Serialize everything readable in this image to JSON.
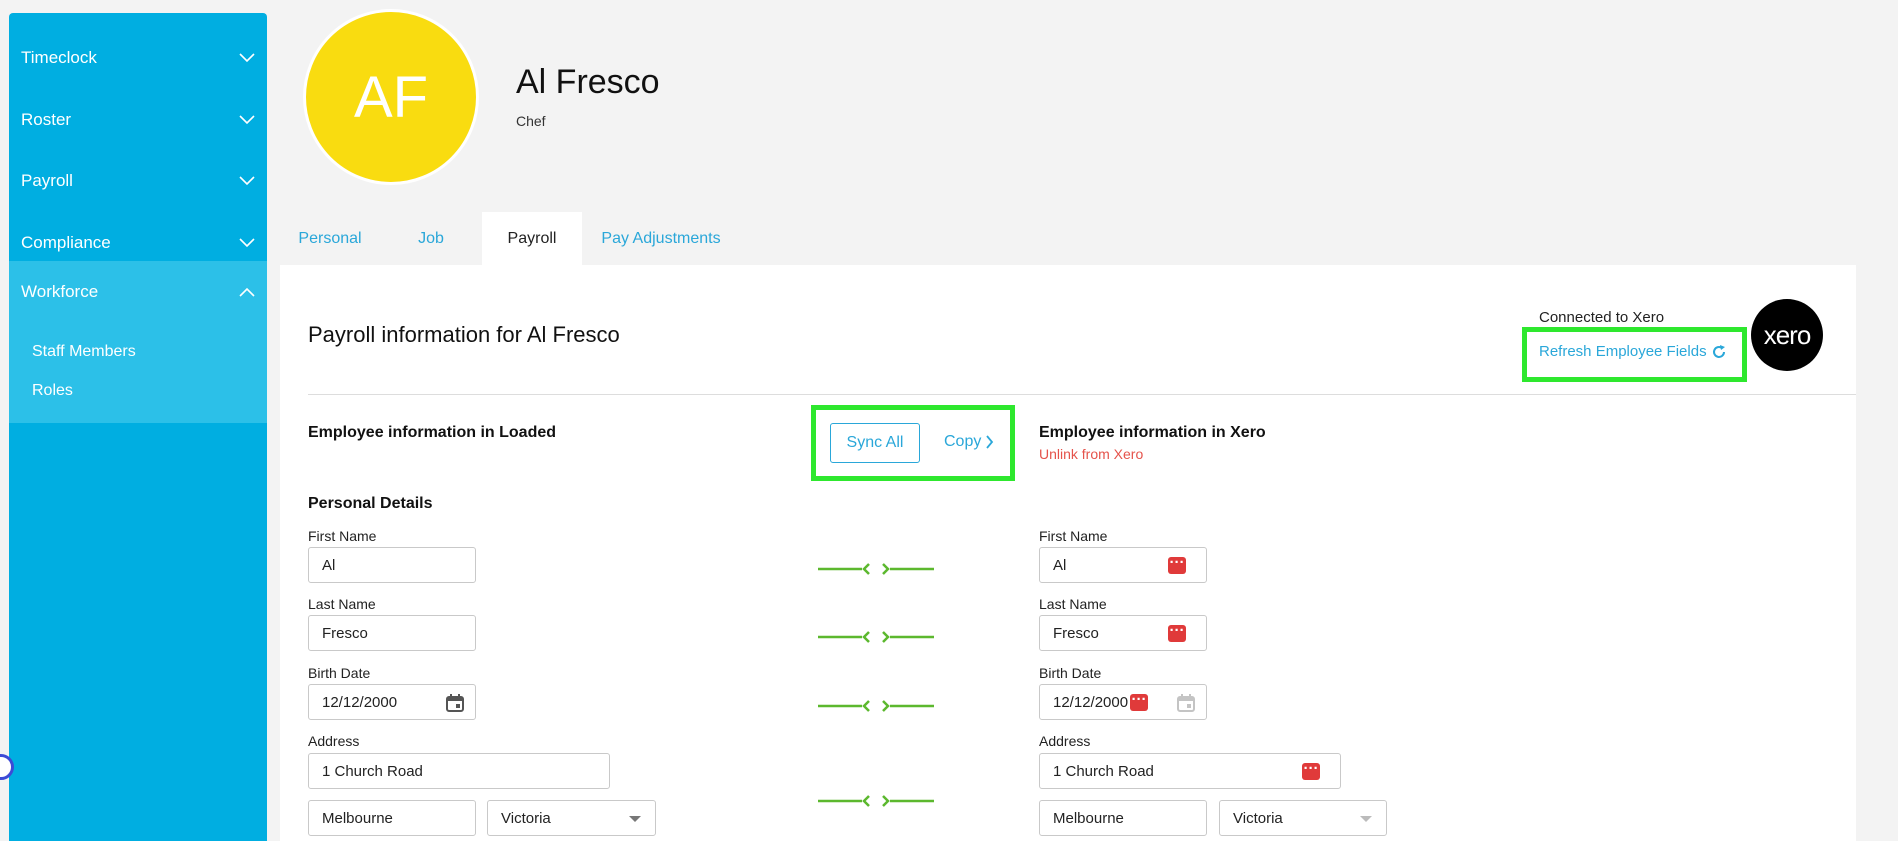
{
  "sidebar": {
    "items": [
      {
        "label": "Timeclock"
      },
      {
        "label": "Roster"
      },
      {
        "label": "Payroll"
      },
      {
        "label": "Compliance"
      },
      {
        "label": "Workforce"
      }
    ],
    "sub_items": [
      {
        "label": "Staff Members"
      },
      {
        "label": "Roles"
      }
    ]
  },
  "employee": {
    "initials": "AF",
    "name": "Al Fresco",
    "role": "Chef"
  },
  "tabs": [
    {
      "label": "Personal",
      "active": false
    },
    {
      "label": "Job",
      "active": false
    },
    {
      "label": "Payroll",
      "active": true
    },
    {
      "label": "Pay Adjustments",
      "active": false
    }
  ],
  "payroll": {
    "title": "Payroll information for Al Fresco",
    "connected_text": "Connected to Xero",
    "refresh_label": "Refresh Employee Fields",
    "xero_logo_text": "xero",
    "left_heading": "Employee information in Loaded",
    "right_heading": "Employee information in Xero",
    "unlink_label": "Unlink from Xero",
    "sync_all_label": "Sync All",
    "copy_label": "Copy",
    "section_title": "Personal Details",
    "labels": {
      "first_name": "First Name",
      "last_name": "Last Name",
      "birth_date": "Birth Date",
      "address": "Address"
    },
    "loaded": {
      "first_name": "Al",
      "last_name": "Fresco",
      "birth_date": "12/12/2000",
      "address": "1 Church Road",
      "city": "Melbourne",
      "state": "Victoria"
    },
    "xero": {
      "first_name": "Al",
      "last_name": "Fresco",
      "birth_date": "12/12/2000",
      "address": "1 Church Road",
      "city": "Melbourne",
      "state": "Victoria"
    }
  },
  "colors": {
    "sidebar": "#00aee1",
    "sidebar_open": "#2cc0e8",
    "accent": "#2aa7d9",
    "avatar": "#f9dc10",
    "highlight": "#2ee82e",
    "link_ok": "#5cb82e",
    "danger": "#e03a3a"
  }
}
